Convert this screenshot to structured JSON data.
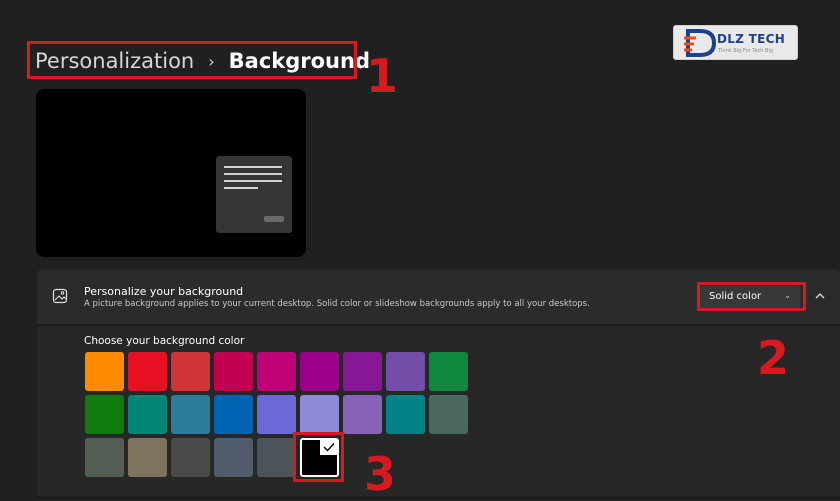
{
  "breadcrumb": {
    "parent": "Personalization",
    "separator": "›",
    "current": "Background"
  },
  "annotations": {
    "one": "1",
    "two": "2",
    "three": "3"
  },
  "logo": {
    "text": "DLZ TECH",
    "subtext": "Think Big For Tech Big"
  },
  "personalize": {
    "title": "Personalize your background",
    "description": "A picture background applies to your current desktop. Solid color or slideshow backgrounds apply to all your desktops.",
    "dropdown_value": "Solid color"
  },
  "color_section": {
    "label": "Choose your background color",
    "rows": [
      [
        "#ff8c00",
        "#e81123",
        "#d13438",
        "#c30052",
        "#bf0077",
        "#9a0089",
        "#881798",
        "#744da9",
        "#10893e"
      ],
      [
        "#107c10",
        "#018574",
        "#2d7d9a",
        "#0063b1",
        "#6b69d6",
        "#8e8cd8",
        "#8764b8",
        "#038387",
        "#486860"
      ],
      [
        "#525e54",
        "#7e735f",
        "#4c4a48",
        "#515c6b",
        "#4a5459"
      ]
    ],
    "selected_color": "#000000"
  },
  "colors": {
    "highlight": "#d71920",
    "accent": "#ffffff"
  },
  "icons": {
    "picture": "picture-icon",
    "chevron_down": "chevron-down-icon",
    "chevron_up": "chevron-up-icon",
    "check": "check-icon"
  }
}
